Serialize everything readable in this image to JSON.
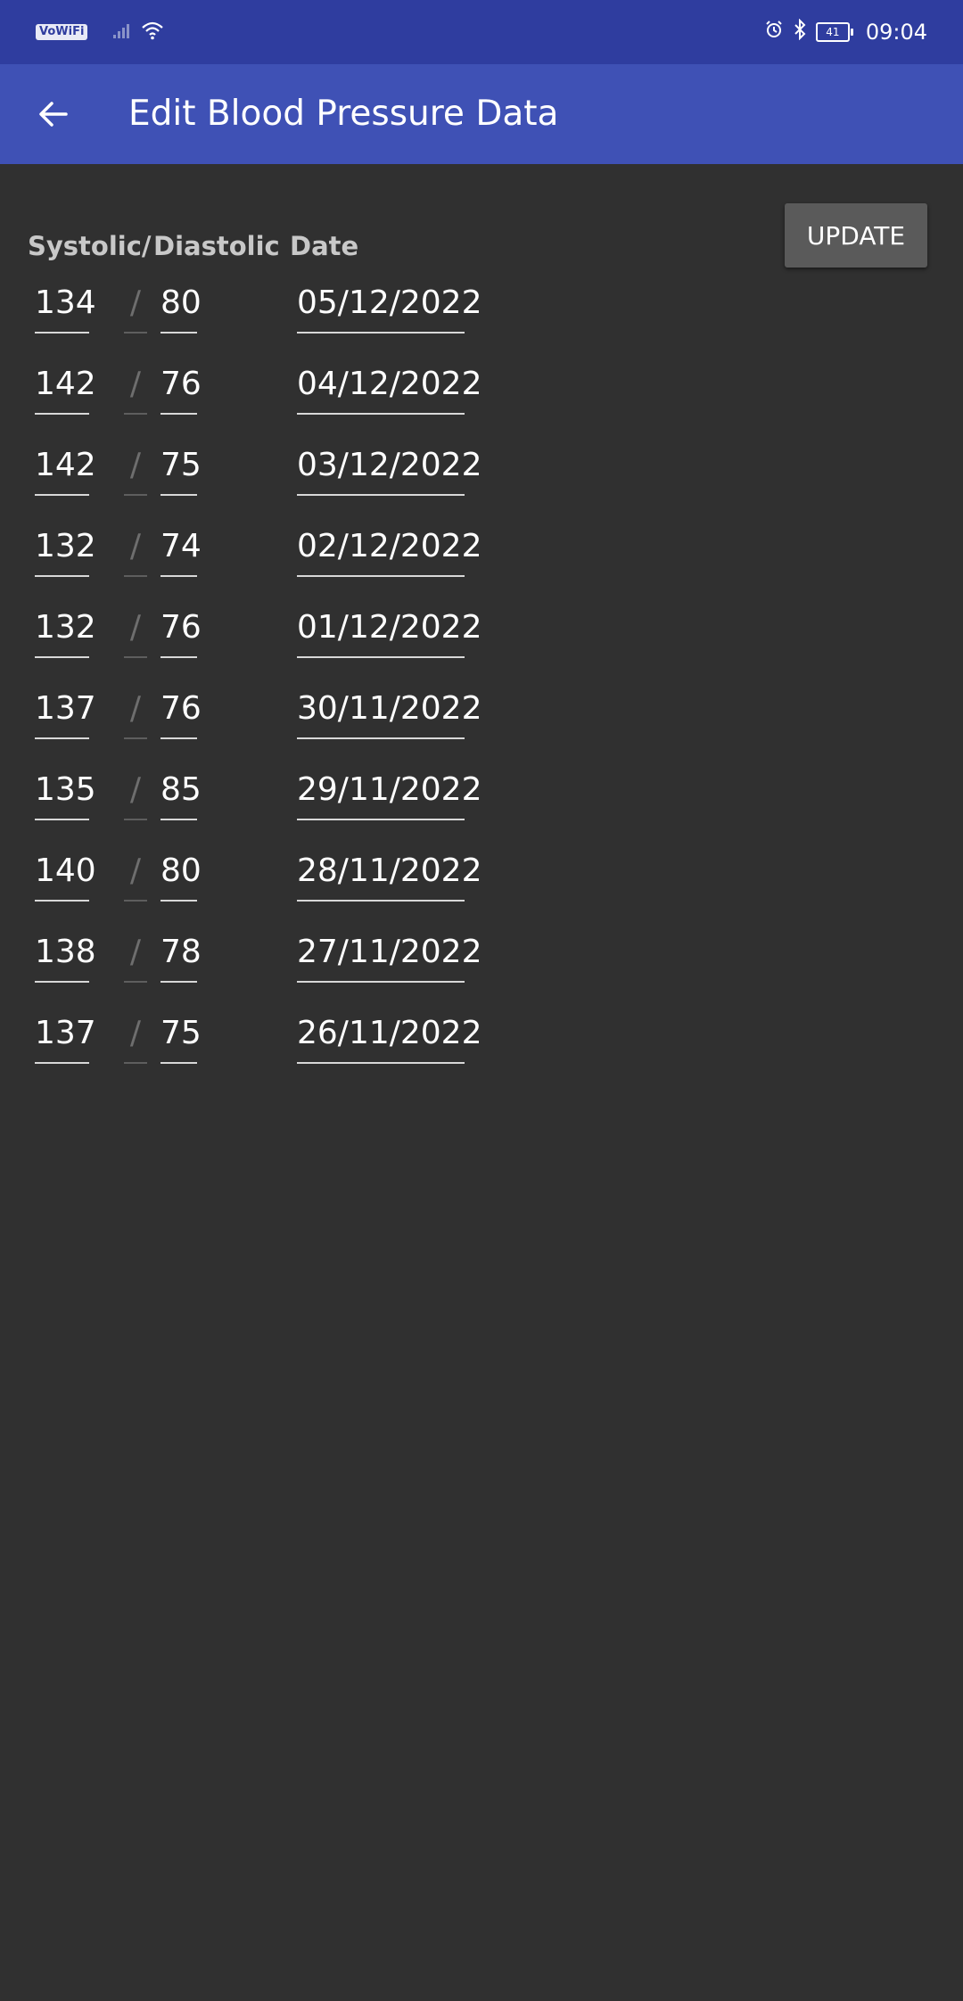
{
  "status_bar": {
    "network_label": "VoWiFi",
    "time": "09:04",
    "battery_level": "41"
  },
  "app_bar": {
    "title": "Edit Blood Pressure Data"
  },
  "update_label": "UPDATE",
  "headers": {
    "systolic": "Systolic/",
    "diastolic": "Diastolic",
    "date": "Date"
  },
  "separator": "/",
  "rows": [
    {
      "systolic": "134",
      "diastolic": "80",
      "date": "05/12/2022"
    },
    {
      "systolic": "142",
      "diastolic": "76",
      "date": "04/12/2022"
    },
    {
      "systolic": "142",
      "diastolic": "75",
      "date": "03/12/2022"
    },
    {
      "systolic": "132",
      "diastolic": "74",
      "date": "02/12/2022"
    },
    {
      "systolic": "132",
      "diastolic": "76",
      "date": "01/12/2022"
    },
    {
      "systolic": "137",
      "diastolic": "76",
      "date": "30/11/2022"
    },
    {
      "systolic": "135",
      "diastolic": "85",
      "date": "29/11/2022"
    },
    {
      "systolic": "140",
      "diastolic": "80",
      "date": "28/11/2022"
    },
    {
      "systolic": "138",
      "diastolic": "78",
      "date": "27/11/2022"
    },
    {
      "systolic": "137",
      "diastolic": "75",
      "date": "26/11/2022"
    }
  ]
}
